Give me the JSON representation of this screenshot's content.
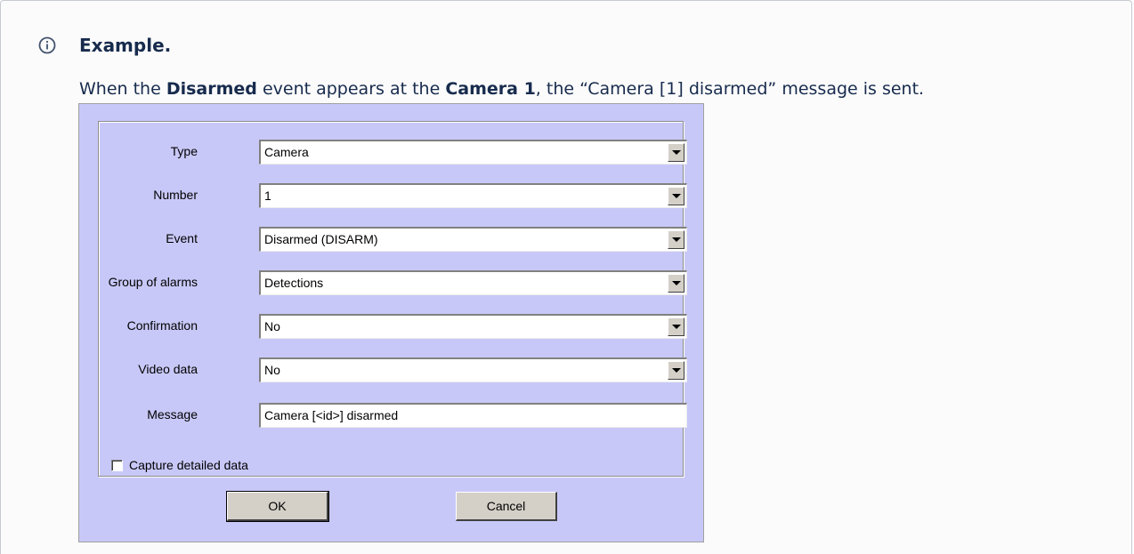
{
  "note": {
    "icon": "info-icon",
    "title": "Example.",
    "text_parts": {
      "p1": "When the ",
      "b1": "Disarmed",
      "p2": " event appears at the ",
      "b2": "Camera 1",
      "p3": ", the “Camera [1] disarmed” message is sent."
    }
  },
  "dialog": {
    "fields": [
      {
        "label": "Type",
        "value": "Camera"
      },
      {
        "label": "Number",
        "value": "1"
      },
      {
        "label": "Event",
        "value": "Disarmed (DISARM)"
      },
      {
        "label": "Group of alarms",
        "value": "Detections"
      },
      {
        "label": "Confirmation",
        "value": "No"
      },
      {
        "label": "Video data",
        "value": "No"
      }
    ],
    "message": {
      "label": "Message",
      "value": "Camera [<id>] disarmed"
    },
    "capture": {
      "label": "Capture detailed data",
      "checked": false
    },
    "buttons": {
      "ok": "OK",
      "cancel": "Cancel"
    }
  }
}
